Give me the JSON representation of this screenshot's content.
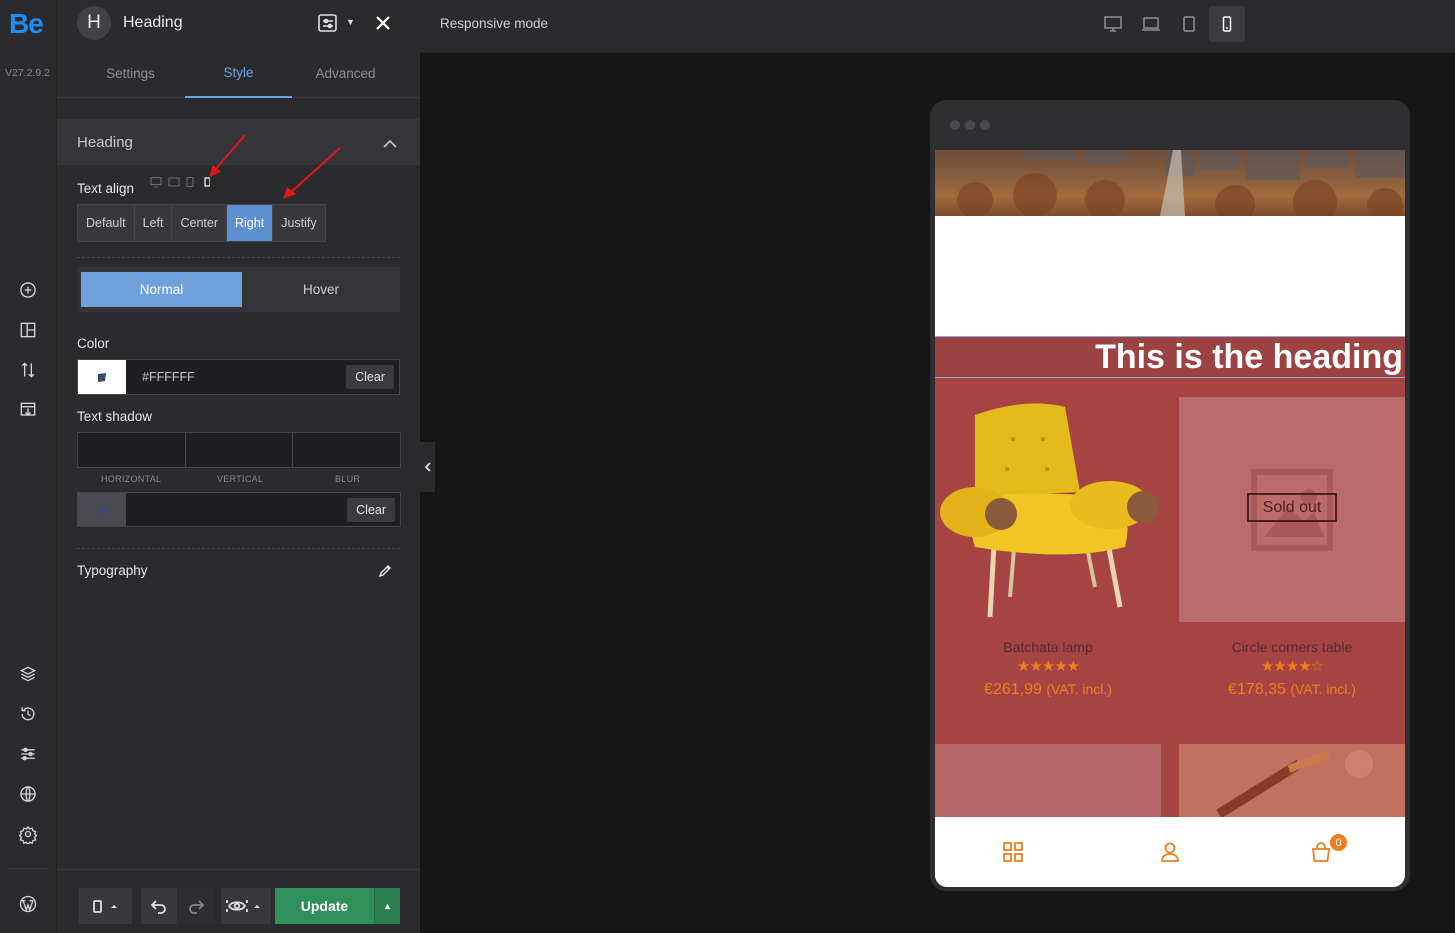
{
  "rail": {
    "logo": "Be",
    "version": "V27.2.9.2",
    "icons": [
      "add-icon",
      "layout-icon",
      "sort-icon",
      "import-icon",
      "layers-icon",
      "history-icon",
      "sliders-icon",
      "globe-icon",
      "settings-icon",
      "wordpress-icon"
    ]
  },
  "panel": {
    "badge": "H",
    "title": "Heading",
    "tabs": [
      "Settings",
      "Style",
      "Advanced"
    ],
    "active_tab": "Style",
    "section_title": "Heading",
    "text_align_label": "Text align",
    "align_options": [
      "Default",
      "Left",
      "Center",
      "Right",
      "Justify"
    ],
    "align_selected": "Right",
    "state_toggle": {
      "normal": "Normal",
      "hover": "Hover",
      "active": "Normal"
    },
    "color_label": "Color",
    "color_value": "#FFFFFF",
    "clear_label": "Clear",
    "text_shadow_label": "Text shadow",
    "shadow_fields": [
      "HORIZONTAL",
      "VERTICAL",
      "BLUR"
    ],
    "typography_label": "Typography"
  },
  "bottom": {
    "update_label": "Update"
  },
  "topbar": {
    "title": "Responsive mode",
    "devices": [
      "desktop-icon",
      "laptop-icon",
      "tablet-icon",
      "mobile-icon"
    ],
    "active_device": "mobile-icon"
  },
  "preview": {
    "heading": "This is the heading",
    "products": [
      {
        "name": "Batchata lamp",
        "rating": 5,
        "price": "€261,99",
        "tax": "(VAT. incl.)"
      },
      {
        "name": "Circle corners table",
        "rating": 4,
        "price": "€178,35",
        "tax": "(VAT. incl.)",
        "badge": "Sold out"
      }
    ],
    "stars_5": "★★★★★",
    "stars_4": "★★★★☆",
    "cart_count": "0",
    "colors": {
      "accent": "#f07e1c",
      "bg": "#a64444",
      "heading_bg": "#9d4242"
    }
  }
}
